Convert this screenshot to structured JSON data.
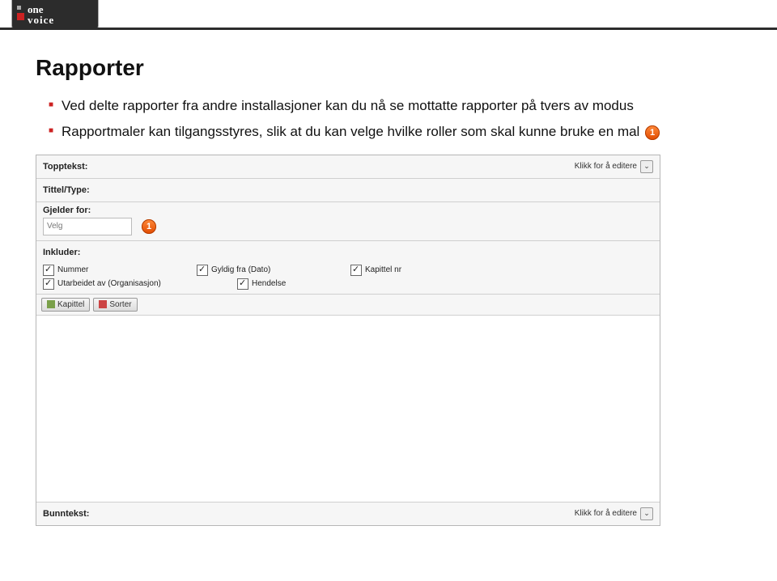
{
  "brand": {
    "name_upper": "one",
    "name_lower": "voice"
  },
  "heading": "Rapporter",
  "bullets": {
    "b1": "Ved delte rapporter fra andre installasjoner kan du nå se mottatte rapporter på tvers av modus",
    "b2": "Rapportmaler kan tilgangsstyres, slik at du kan velge hvilke roller som skal kunne bruke en mal"
  },
  "badge1": "1",
  "panel": {
    "topptekst": "Topptekst:",
    "edit": "Klikk for å editere",
    "tittel": "Tittel/Type:",
    "gjelder": "Gjelder for:",
    "velg": "Velg",
    "inkluder": "Inkluder:",
    "checks": {
      "nummer": "Nummer",
      "gyldig": "Gyldig fra (Dato)",
      "kapittelnr": "Kapittel nr",
      "utarb": "Utarbeidet av (Organisasjon)",
      "hendelse": "Hendelse"
    },
    "btn_kapittel": "Kapittel",
    "btn_sorter": "Sorter",
    "bunntekst": "Bunntekst:"
  }
}
